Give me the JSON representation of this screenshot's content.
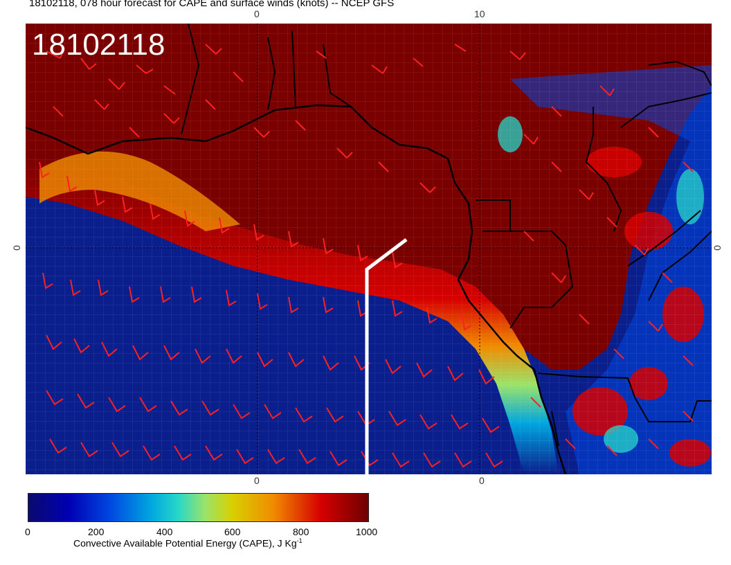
{
  "title": "18102118, 078 hour forecast for CAPE and surface winds (knots) -- NCEP GFS",
  "stamp": "18102118",
  "ticks": {
    "top_0": "0",
    "top_10": "10",
    "bottom_0": "0",
    "bottom_10": "0",
    "left_0": "0",
    "right_0": "0"
  },
  "colorbar": {
    "labels": [
      "0",
      "200",
      "400",
      "600",
      "800",
      "1000"
    ],
    "title": "Convective Available Potential Energy (CAPE), J Kg",
    "title_sup": "-1",
    "colors": [
      "#0a0a6e",
      "#0000b4",
      "#0047e0",
      "#00a6e0",
      "#26d7c9",
      "#9be36a",
      "#d8d000",
      "#f08c00",
      "#d60000",
      "#6e0000"
    ]
  },
  "field_colors": {
    "high_cape": "#7a0000",
    "low_cape": "#0a1e8c",
    "wind_barbs": "#ff0000",
    "coastline": "#000000",
    "transect": "#ffffff"
  }
}
